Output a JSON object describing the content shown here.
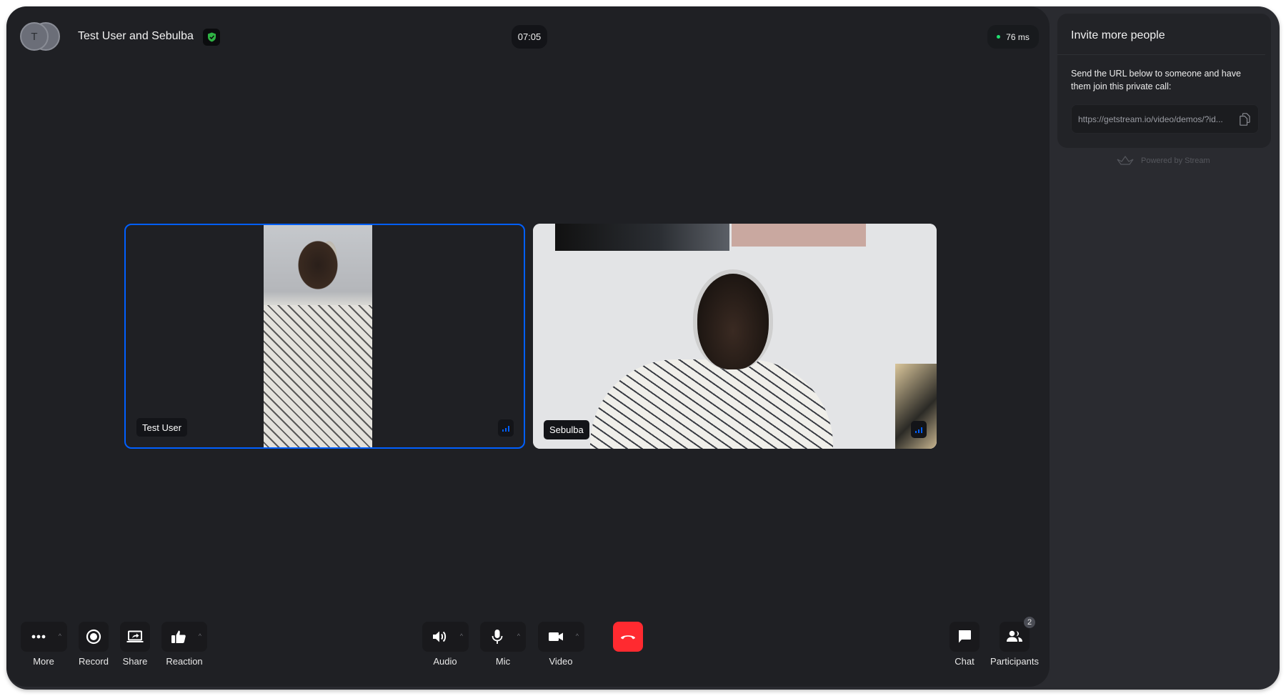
{
  "header": {
    "avatar_initial": "T",
    "call_title": "Test User and Sebulba",
    "secure_icon": "shield-check-icon",
    "timer": "07:05",
    "latency": "76 ms",
    "latency_status_color": "#20e070"
  },
  "participants": [
    {
      "name": "Test User",
      "signal_icon": "signal-bars-icon",
      "highlighted": true
    },
    {
      "name": "Sebulba",
      "signal_icon": "signal-bars-icon",
      "highlighted": false
    }
  ],
  "controls": {
    "left": [
      {
        "label": "More",
        "icon": "more-dots-icon",
        "has_menu": true
      },
      {
        "label": "Record",
        "icon": "record-icon",
        "has_menu": false
      },
      {
        "label": "Share",
        "icon": "screen-share-icon",
        "has_menu": false
      },
      {
        "label": "Reaction",
        "icon": "thumbs-up-icon",
        "has_menu": true
      }
    ],
    "center": [
      {
        "label": "Audio",
        "icon": "speaker-icon",
        "has_menu": true
      },
      {
        "label": "Mic",
        "icon": "microphone-icon",
        "has_menu": true
      },
      {
        "label": "Video",
        "icon": "video-camera-icon",
        "has_menu": true
      },
      {
        "label": "",
        "icon": "hang-up-icon",
        "has_menu": false
      }
    ],
    "right": [
      {
        "label": "Chat",
        "icon": "chat-bubble-icon",
        "has_menu": false
      },
      {
        "label": "Participants",
        "icon": "participants-icon",
        "has_menu": false,
        "badge": "2"
      }
    ]
  },
  "invite_panel": {
    "title": "Invite more people",
    "description": "Send the URL below to someone and have them join this private call:",
    "url": "https://getstream.io/video/demos/?id...",
    "copy_icon": "copy-icon",
    "powered_by": "Powered by Stream"
  },
  "colors": {
    "accent": "#005fff",
    "hangup": "#ff2a30",
    "secure": "#2fb344"
  }
}
